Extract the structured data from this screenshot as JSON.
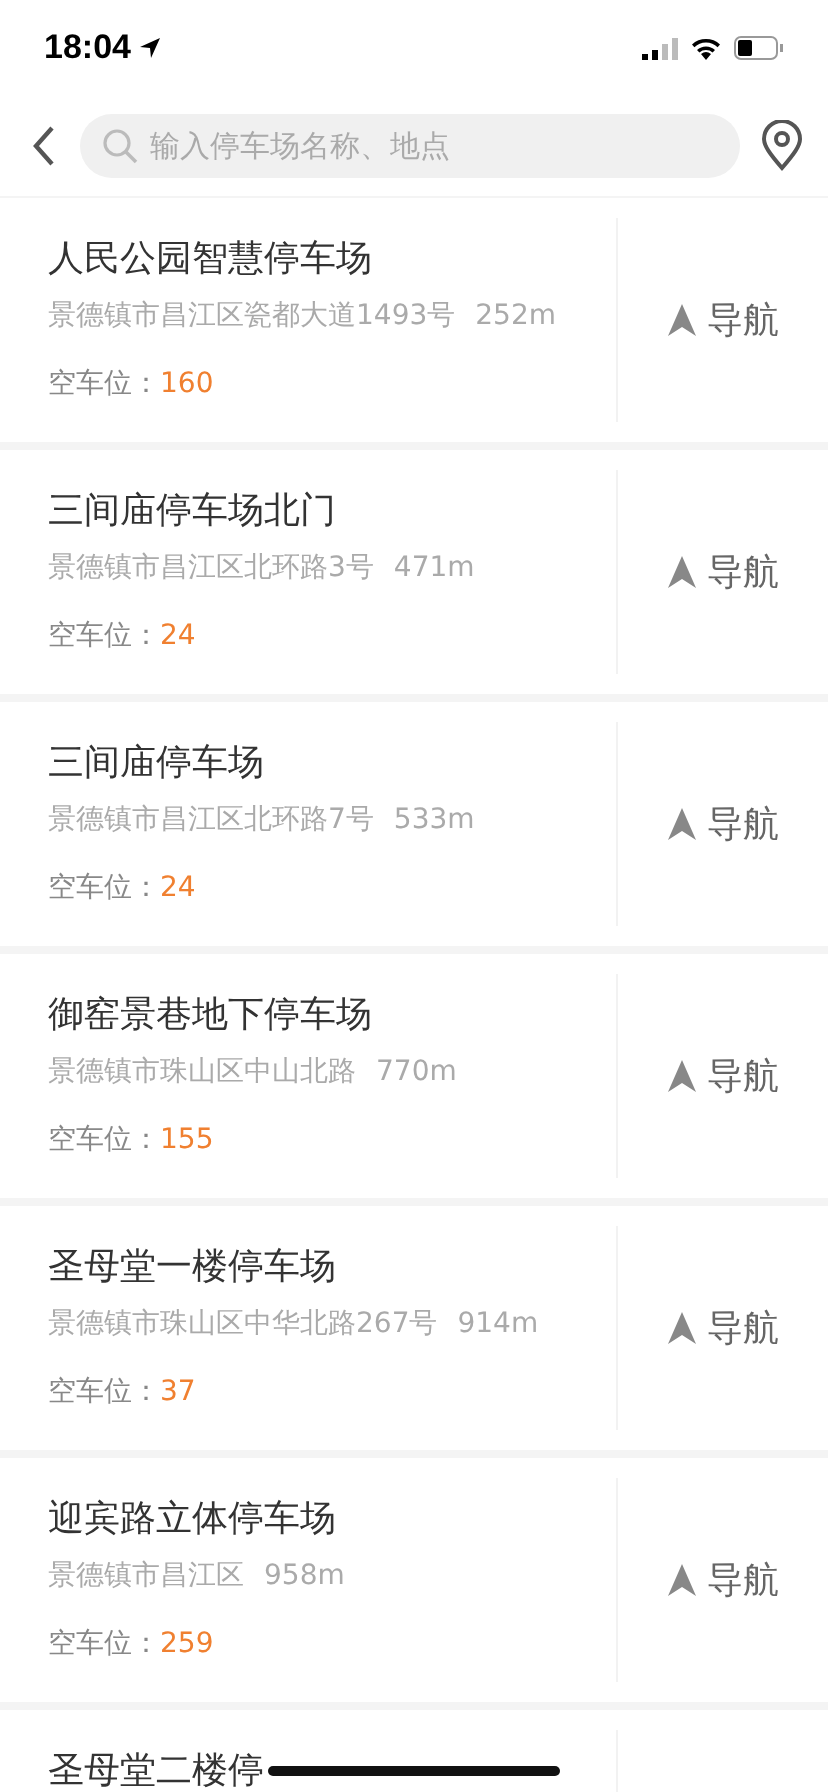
{
  "status_bar": {
    "time": "18:04"
  },
  "search": {
    "placeholder": "输入停车场名称、地点"
  },
  "parkings": [
    {
      "name": "人民公园智慧停车场",
      "address": "景德镇市昌江区瓷都大道1493号",
      "distance": "252m",
      "free_label": "空车位：",
      "free": "160",
      "nav_label": "导航"
    },
    {
      "name": "三间庙停车场北门",
      "address": "景德镇市昌江区北环路3号",
      "distance": "471m",
      "free_label": "空车位：",
      "free": "24",
      "nav_label": "导航"
    },
    {
      "name": "三间庙停车场",
      "address": "景德镇市昌江区北环路7号",
      "distance": "533m",
      "free_label": "空车位：",
      "free": "24",
      "nav_label": "导航"
    },
    {
      "name": "御窑景巷地下停车场",
      "address": "景德镇市珠山区中山北路",
      "distance": "770m",
      "free_label": "空车位：",
      "free": "155",
      "nav_label": "导航"
    },
    {
      "name": "圣母堂一楼停车场",
      "address": "景德镇市珠山区中华北路267号",
      "distance": "914m",
      "free_label": "空车位：",
      "free": "37",
      "nav_label": "导航"
    },
    {
      "name": "迎宾路立体停车场",
      "address": "景德镇市昌江区",
      "distance": "958m",
      "free_label": "空车位：",
      "free": "259",
      "nav_label": "导航"
    },
    {
      "name": "圣母堂二楼停"
    }
  ]
}
